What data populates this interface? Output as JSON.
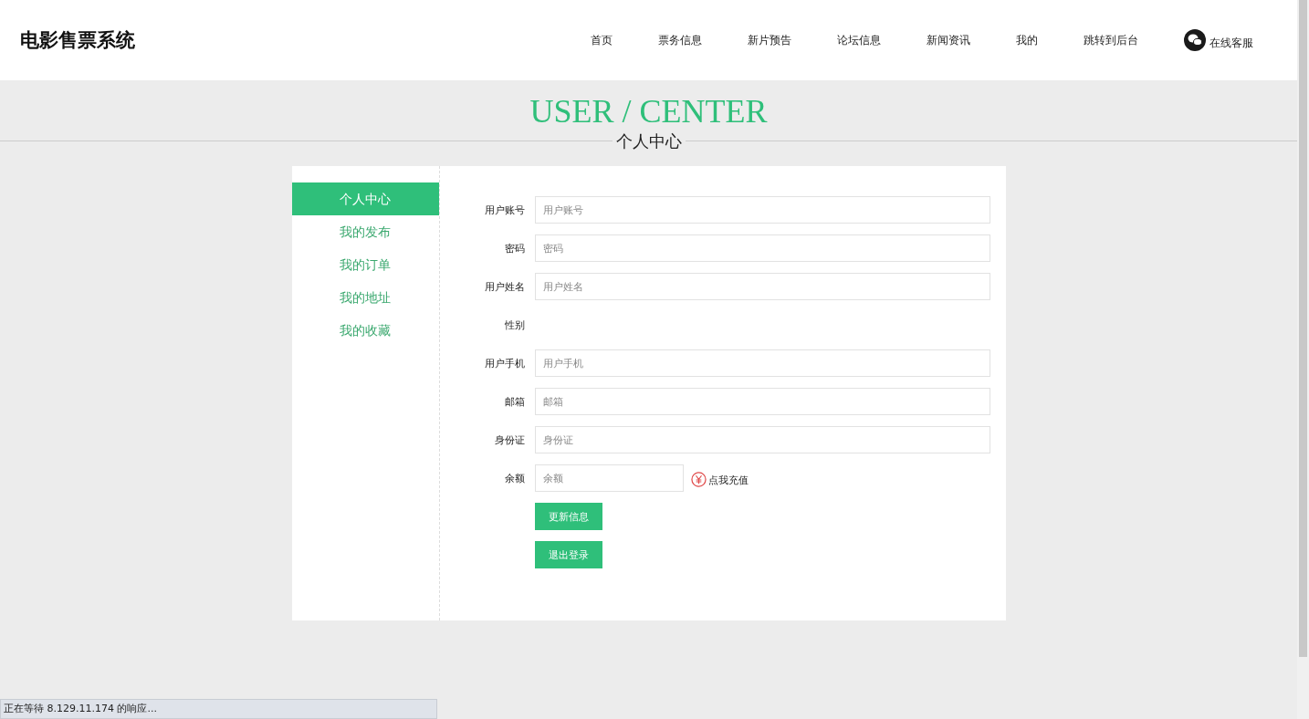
{
  "header": {
    "logo": "电影售票系统",
    "nav": [
      {
        "label": "首页"
      },
      {
        "label": "票务信息"
      },
      {
        "label": "新片预告"
      },
      {
        "label": "论坛信息"
      },
      {
        "label": "新闻资讯"
      },
      {
        "label": "我的"
      },
      {
        "label": "跳转到后台"
      }
    ],
    "service": "在线客服"
  },
  "banner": {
    "title": "USER / CENTER",
    "subtitle": "个人中心"
  },
  "sidebar": {
    "items": [
      {
        "label": "个人中心",
        "selected": true
      },
      {
        "label": "我的发布",
        "selected": false
      },
      {
        "label": "我的订单",
        "selected": false
      },
      {
        "label": "我的地址",
        "selected": false
      },
      {
        "label": "我的收藏",
        "selected": false
      }
    ]
  },
  "form": {
    "fields": [
      {
        "kind": "input",
        "label": "用户账号",
        "placeholder": "用户账号"
      },
      {
        "kind": "input",
        "label": "密码",
        "placeholder": "密码"
      },
      {
        "kind": "input",
        "label": "用户姓名",
        "placeholder": "用户姓名"
      },
      {
        "kind": "empty",
        "label": "性别"
      },
      {
        "kind": "input",
        "label": "用户手机",
        "placeholder": "用户手机"
      },
      {
        "kind": "input",
        "label": "邮箱",
        "placeholder": "邮箱"
      },
      {
        "kind": "input",
        "label": "身份证",
        "placeholder": "身份证"
      },
      {
        "kind": "balance",
        "label": "余额",
        "placeholder": "余额",
        "link": "点我充值"
      }
    ],
    "buttons": [
      "更新信息",
      "退出登录"
    ]
  },
  "status_bar": "正在等待 8.129.11.174 的响应..."
}
